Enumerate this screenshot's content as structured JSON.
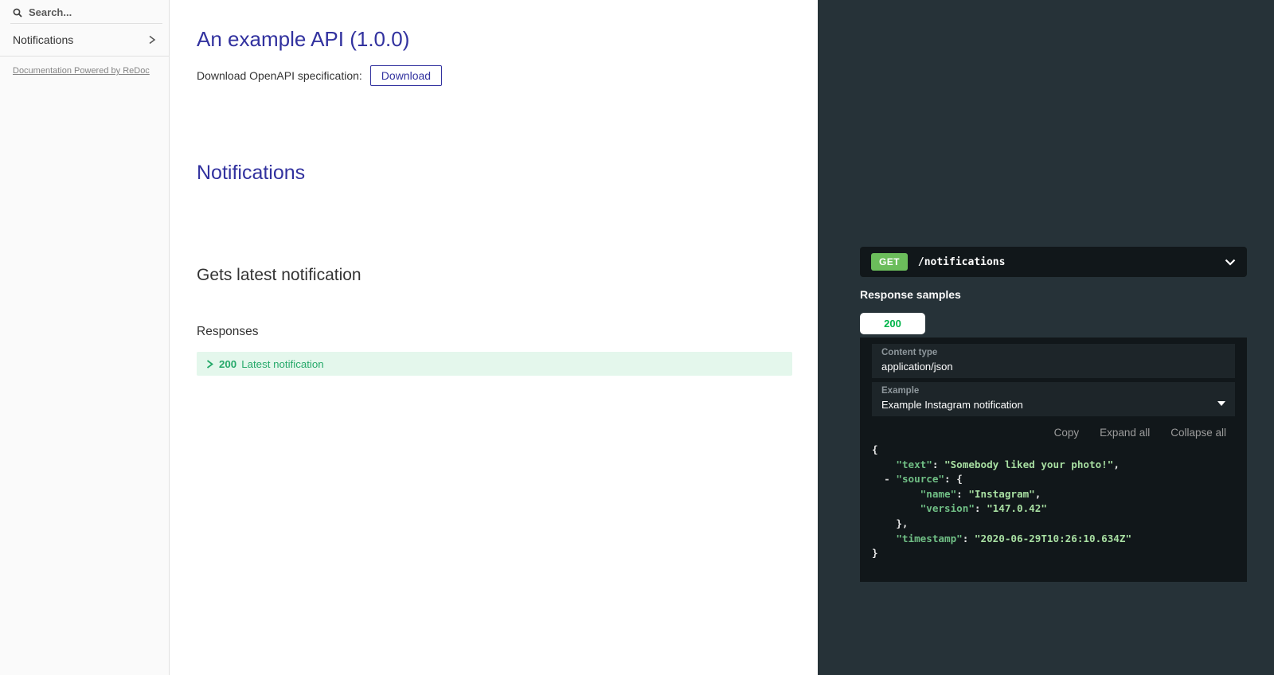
{
  "colors": {
    "accent": "#32329f",
    "get_badge_green": "#6bbd5b",
    "tab_success_green": "#00b44a",
    "response_row_green": "#26a96a",
    "response_row_bg": "#e4f7ec",
    "right_panel_bg": "#263238",
    "code_panel_bg": "#11171a",
    "json_key_color": "#70bf85",
    "json_string_color": "#a8dfa2"
  },
  "sidebar": {
    "search_placeholder": "Search...",
    "items": [
      {
        "label": "Notifications"
      }
    ],
    "powered_by": "Documentation Powered by ReDoc"
  },
  "content": {
    "api_title": "An example API (1.0.0)",
    "download_label": "Download OpenAPI specification:",
    "download_button": "Download",
    "section_title": "Notifications",
    "operation_title": "Gets latest notification",
    "responses_label": "Responses",
    "response": {
      "code": "200",
      "description": "Latest notification"
    }
  },
  "right_panel": {
    "method": "GET",
    "path": "/notifications",
    "samples_title": "Response samples",
    "tabs": [
      {
        "label": "200"
      }
    ],
    "sample": {
      "content_type_label": "Content type",
      "content_type_value": "application/json",
      "example_label": "Example",
      "example_value": "Example Instagram notification",
      "actions": {
        "copy": "Copy",
        "expand": "Expand all",
        "collapse": "Collapse all"
      },
      "code_lines": [
        [
          {
            "t": "p",
            "v": "{"
          }
        ],
        [
          {
            "t": "w",
            "v": "    "
          },
          {
            "t": "k",
            "v": "\"text\""
          },
          {
            "t": "p",
            "v": ": "
          },
          {
            "t": "s",
            "v": "\"Somebody liked your photo!\""
          },
          {
            "t": "p",
            "v": ","
          }
        ],
        [
          {
            "t": "w",
            "v": "  "
          },
          {
            "t": "tg",
            "v": "-"
          },
          {
            "t": "w",
            "v": " "
          },
          {
            "t": "k",
            "v": "\"source\""
          },
          {
            "t": "p",
            "v": ": {"
          }
        ],
        [
          {
            "t": "w",
            "v": "        "
          },
          {
            "t": "k",
            "v": "\"name\""
          },
          {
            "t": "p",
            "v": ": "
          },
          {
            "t": "s",
            "v": "\"Instagram\""
          },
          {
            "t": "p",
            "v": ","
          }
        ],
        [
          {
            "t": "w",
            "v": "        "
          },
          {
            "t": "k",
            "v": "\"version\""
          },
          {
            "t": "p",
            "v": ": "
          },
          {
            "t": "s",
            "v": "\"147.0.42\""
          }
        ],
        [
          {
            "t": "w",
            "v": "    "
          },
          {
            "t": "p",
            "v": "},"
          }
        ],
        [
          {
            "t": "w",
            "v": "    "
          },
          {
            "t": "k",
            "v": "\"timestamp\""
          },
          {
            "t": "p",
            "v": ": "
          },
          {
            "t": "s",
            "v": "\"2020-06-29T10:26:10.634Z\""
          }
        ],
        [
          {
            "t": "p",
            "v": "}"
          }
        ]
      ]
    }
  }
}
